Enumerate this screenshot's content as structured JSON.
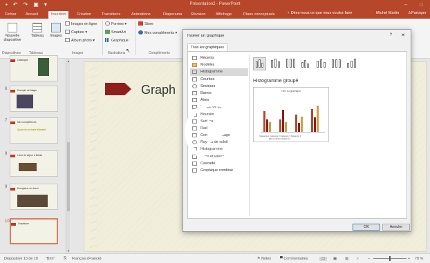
{
  "window": {
    "title": "Présentation2 - PowerPoint",
    "qat": [
      "save-icon",
      "undo-icon",
      "redo-icon",
      "start-icon",
      "customize-icon"
    ]
  },
  "tabs": [
    {
      "label": "Fichier"
    },
    {
      "label": "Accueil"
    },
    {
      "label": "Insertion",
      "active": true
    },
    {
      "label": "Création"
    },
    {
      "label": "Transitions"
    },
    {
      "label": "Animations"
    },
    {
      "label": "Diaporama"
    },
    {
      "label": "Révision"
    },
    {
      "label": "Affichage"
    },
    {
      "label": "Plans conceptuels"
    }
  ],
  "tell_me": "Dites-nous ce que vous voulez faire",
  "user": "Michel Martin",
  "share": "Partager",
  "ribbon": {
    "new_slide": "Nouvelle diapositive",
    "table": "Tableau",
    "images": "Images",
    "online_images": "Images en ligne",
    "capture": "Capture",
    "album": "Album photo",
    "formes": "Formes",
    "smartart": "SmartArt",
    "graphique": "Graphique",
    "store": "Store",
    "mes_complements": "Mes compléments",
    "groups": {
      "diapositives": "Diapositives",
      "tableaux": "Tableaux",
      "images": "Images",
      "illustrations": "Illustrations",
      "complements": "Compléments"
    }
  },
  "thumbnails": [
    {
      "num": "",
      "text": "Catalogue"
    },
    {
      "num": "6",
      "text": "Exemple de Magie"
    },
    {
      "num": "7",
      "text": "Mes compétences",
      "sub": "Quoi est un texte Wordart"
    },
    {
      "num": "8",
      "text": "Lieux de séjour à Bristol"
    },
    {
      "num": "9",
      "text": "Enregistrer en direct"
    },
    {
      "num": "10",
      "text": "Graphique"
    }
  ],
  "slide": {
    "title": "Graph"
  },
  "dialog": {
    "title": "Insérer un graphique",
    "help": "?",
    "close": "✕",
    "tab": "Tous les graphiques",
    "categories": [
      {
        "label": "Récents",
        "icon": "recent-icon"
      },
      {
        "label": "Modèles",
        "icon": "templates-icon"
      },
      {
        "label": "Histogramme",
        "icon": "column-chart-icon",
        "selected": true
      },
      {
        "label": "Courbes",
        "icon": "line-chart-icon"
      },
      {
        "label": "Secteurs",
        "icon": "pie-chart-icon"
      },
      {
        "label": "Barres",
        "icon": "bar-chart-icon"
      },
      {
        "label": "Aires",
        "icon": "area-chart-icon"
      },
      {
        "label": "Nuage de points",
        "icon": "scatter-chart-icon"
      },
      {
        "label": "Boursier",
        "icon": "stock-chart-icon"
      },
      {
        "label": "Surface",
        "icon": "surface-chart-icon"
      },
      {
        "label": "Radar",
        "icon": "radar-chart-icon"
      },
      {
        "label": "Compartimentage",
        "icon": "treemap-icon"
      },
      {
        "label": "Rayons de soleil",
        "icon": "sunburst-icon"
      },
      {
        "label": "Histogramme",
        "icon": "histogram-icon"
      },
      {
        "label": "Zone et valeur",
        "icon": "box-whisker-icon"
      },
      {
        "label": "Cascade",
        "icon": "waterfall-icon"
      },
      {
        "label": "Graphique combiné",
        "icon": "combo-chart-icon"
      }
    ],
    "subtype_title": "Histogramme groupé",
    "preview_title": "Titre du graphique",
    "preview_categories": "Catégorie 1  Catégorie 2  Catégorie 3  Catégorie 4",
    "preview_legend": "■Série1  ■Série2  ■Série3",
    "ok": "OK",
    "cancel": "Annuler"
  },
  "status": {
    "slide": "Diapositive 10 de 10",
    "theme": "\"Brin\"",
    "lang": "Français (France)",
    "notes": "Notes",
    "comments": "Commentaires",
    "zoom": "78 %"
  },
  "colors": {
    "accent": "#b7472a",
    "series": [
      "#b04a2e",
      "#8f1f1a",
      "#d79a3e"
    ]
  }
}
